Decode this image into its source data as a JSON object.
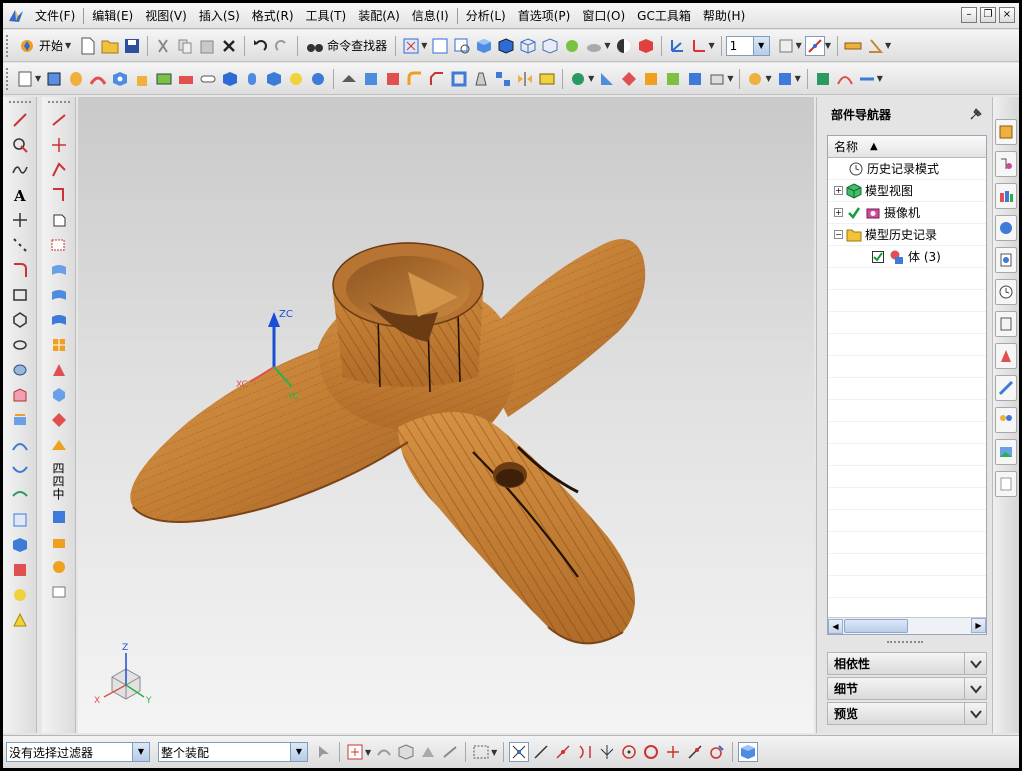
{
  "menubar": {
    "items": [
      "文件(F)",
      "编辑(E)",
      "视图(V)",
      "插入(S)",
      "格式(R)",
      "工具(T)",
      "装配(A)",
      "信息(I)",
      "分析(L)",
      "首选项(P)",
      "窗口(O)",
      "GC工具箱",
      "帮助(H)"
    ]
  },
  "toolbar": {
    "start_label": "开始",
    "command_finder_label": "命令查找器",
    "layer_value": "1"
  },
  "left_tools": {
    "vertical_label": "四四中"
  },
  "viewport": {
    "triad_label": "ZC",
    "triad_x_label": "XC",
    "triad_y_label": "YC",
    "mini_axes": {
      "z": "Z",
      "x": "X",
      "y": "Y"
    }
  },
  "navigator": {
    "title": "部件导航器",
    "column_header": "名称",
    "rows": [
      {
        "label": "历史记录模式"
      },
      {
        "label": "模型视图"
      },
      {
        "label": "摄像机"
      },
      {
        "label": "模型历史记录"
      },
      {
        "label": "体 (3)"
      }
    ],
    "panels": [
      "相依性",
      "细节",
      "预览"
    ]
  },
  "statusbar": {
    "filter_value": "没有选择过滤器",
    "assembly_value": "整个装配"
  },
  "colors": {
    "accent": "#2f6bd4",
    "wood": "#c8843c",
    "wood_dark": "#8a5220"
  }
}
